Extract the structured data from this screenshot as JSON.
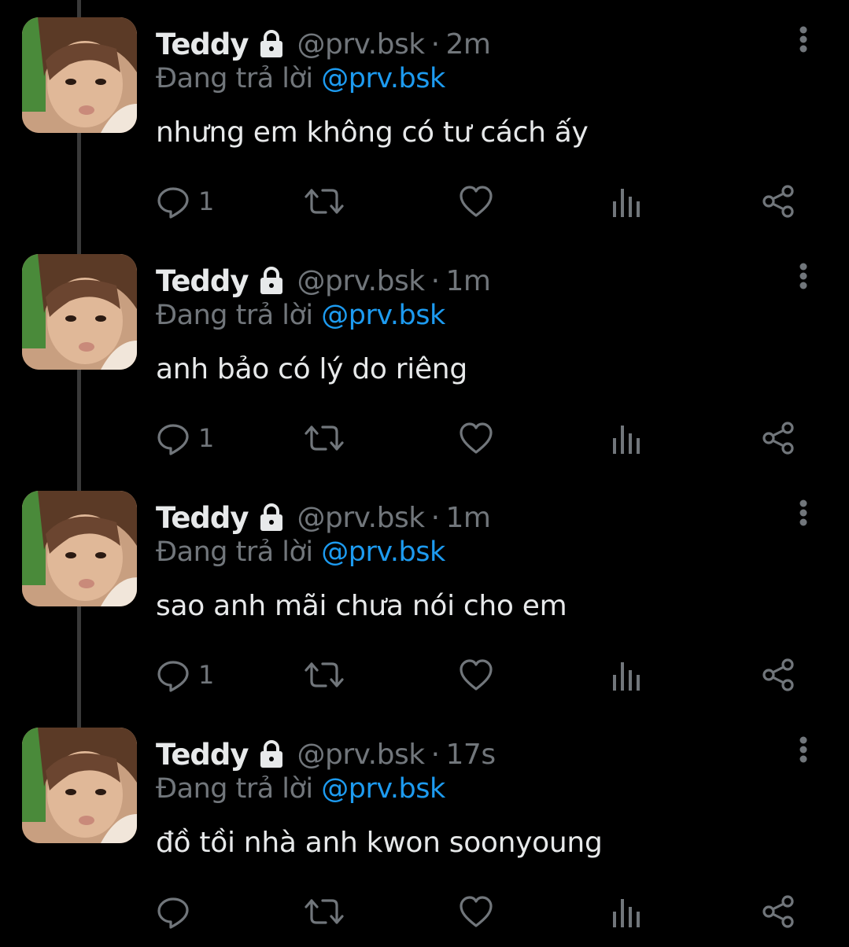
{
  "tweets": [
    {
      "name": "Teddy",
      "handle": "@prv.bsk",
      "separator": "·",
      "time": "2m",
      "reply_prefix": "Đang trả lời",
      "reply_to": "@prv.bsk",
      "text": "nhưng em không có tư cách ấy",
      "reply_count": "1"
    },
    {
      "name": "Teddy",
      "handle": "@prv.bsk",
      "separator": "·",
      "time": "1m",
      "reply_prefix": "Đang trả lời",
      "reply_to": "@prv.bsk",
      "text": "anh bảo có lý do riêng",
      "reply_count": "1"
    },
    {
      "name": "Teddy",
      "handle": "@prv.bsk",
      "separator": "·",
      "time": "1m",
      "reply_prefix": "Đang trả lời",
      "reply_to": "@prv.bsk",
      "text": "sao anh mãi chưa nói cho em",
      "reply_count": "1"
    },
    {
      "name": "Teddy",
      "handle": "@prv.bsk",
      "separator": "·",
      "time": "17s",
      "reply_prefix": "Đang trả lời",
      "reply_to": "@prv.bsk",
      "text": "đồ tồi nhà anh kwon soonyoung",
      "reply_count": ""
    }
  ],
  "icons": {
    "reply": "reply-icon",
    "retweet": "retweet-icon",
    "like": "heart-icon",
    "views": "views-icon",
    "share": "share-icon",
    "more": "more-vertical-icon",
    "protected": "lock-icon"
  },
  "colors": {
    "background": "#000000",
    "text": "#e7e9ea",
    "secondary": "#71767b",
    "link": "#1d9bf0",
    "thread_line": "#3a3a3a"
  }
}
